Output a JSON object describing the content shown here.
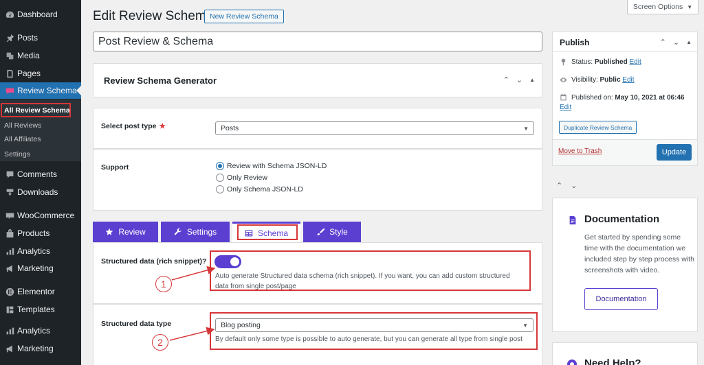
{
  "sidebar": {
    "items": [
      {
        "label": "Dashboard",
        "icon": "dashboard-icon"
      },
      {
        "label": "Posts",
        "icon": "pin-icon"
      },
      {
        "label": "Media",
        "icon": "media-icon"
      },
      {
        "label": "Pages",
        "icon": "pages-icon"
      },
      {
        "label": "Review Schema",
        "icon": "review-schema-icon",
        "active": true
      },
      {
        "label": "Comments",
        "icon": "comment-icon"
      },
      {
        "label": "Downloads",
        "icon": "download-icon"
      },
      {
        "label": "WooCommerce",
        "icon": "woocommerce-icon"
      },
      {
        "label": "Products",
        "icon": "products-icon"
      },
      {
        "label": "Analytics",
        "icon": "analytics-icon"
      },
      {
        "label": "Marketing",
        "icon": "megaphone-icon"
      },
      {
        "label": "Elementor",
        "icon": "elementor-icon"
      },
      {
        "label": "Templates",
        "icon": "templates-icon"
      },
      {
        "label": "Analytics",
        "icon": "analytics-icon"
      },
      {
        "label": "Marketing",
        "icon": "megaphone-icon"
      }
    ],
    "submenu": [
      "All Review Schema",
      "All Reviews",
      "All Affiliates",
      "Settings"
    ]
  },
  "header": {
    "title": "Edit Review Schema",
    "new_button": "New Review Schema",
    "screen_options": "Screen Options",
    "post_title": "Post Review & Schema"
  },
  "generator": {
    "title": "Review Schema Generator",
    "post_type_label": "Select post type",
    "post_type_value": "Posts",
    "support_label": "Support",
    "support_options": [
      "Review with Schema JSON-LD",
      "Only Review",
      "Only Schema JSON-LD"
    ],
    "support_selected": 0
  },
  "tabs": [
    {
      "label": "Review",
      "icon": "star-icon"
    },
    {
      "label": "Settings",
      "icon": "wrench-icon"
    },
    {
      "label": "Schema",
      "icon": "table-icon",
      "active": true
    },
    {
      "label": "Style",
      "icon": "brush-icon"
    }
  ],
  "schema": {
    "structured_label": "Structured data (rich snippet)?",
    "structured_enabled": true,
    "structured_help": "Auto generate Structured data schema (rich snippet). If you want, you can add custom structured data from single post/page",
    "type_label": "Structured data type",
    "type_value": "Blog posting",
    "type_help": "By default only some type is possible to auto generate, but you can generate all type from single post",
    "annotation_1": "1",
    "annotation_2": "2"
  },
  "publish": {
    "title": "Publish",
    "status_label": "Status:",
    "status_value": "Published",
    "visibility_label": "Visibility:",
    "visibility_value": "Public",
    "published_label": "Published on:",
    "published_value": "May 10, 2021 at 06:46",
    "edit": "Edit",
    "duplicate": "Duplicate Review Schema",
    "trash": "Move to Trash",
    "update": "Update"
  },
  "documentation": {
    "title": "Documentation",
    "text": "Get started by spending some time with the documentation we included step by step process with screenshots with video.",
    "button": "Documentation"
  },
  "help": {
    "title": "Need Help?"
  },
  "colors": {
    "accent": "#5b3fd1",
    "wp_blue": "#2271b1",
    "annotation_red": "#d63638"
  }
}
